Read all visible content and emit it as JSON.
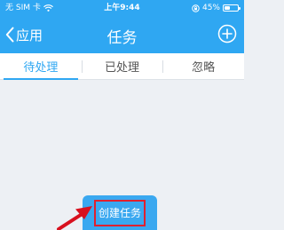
{
  "status_bar": {
    "carrier": "无 SIM 卡",
    "time": "上午9:44",
    "battery_percent": "45%",
    "battery_level": 0.45
  },
  "nav": {
    "back_label": "应用",
    "title": "任务",
    "back_icon": "chevron-left-icon",
    "add_icon": "plus-circle-icon"
  },
  "tabs": [
    {
      "label": "待处理",
      "active": true
    },
    {
      "label": "已处理",
      "active": false
    },
    {
      "label": "忽略",
      "active": false
    }
  ],
  "actions": {
    "create_task_label": "创建任务"
  },
  "annotation": {
    "arrow_icon": "red-arrow-icon",
    "highlight_color": "#e0202f"
  },
  "colors": {
    "brand": "#2fa7f2",
    "background": "#edf0f4",
    "highlight": "#e0202f"
  }
}
